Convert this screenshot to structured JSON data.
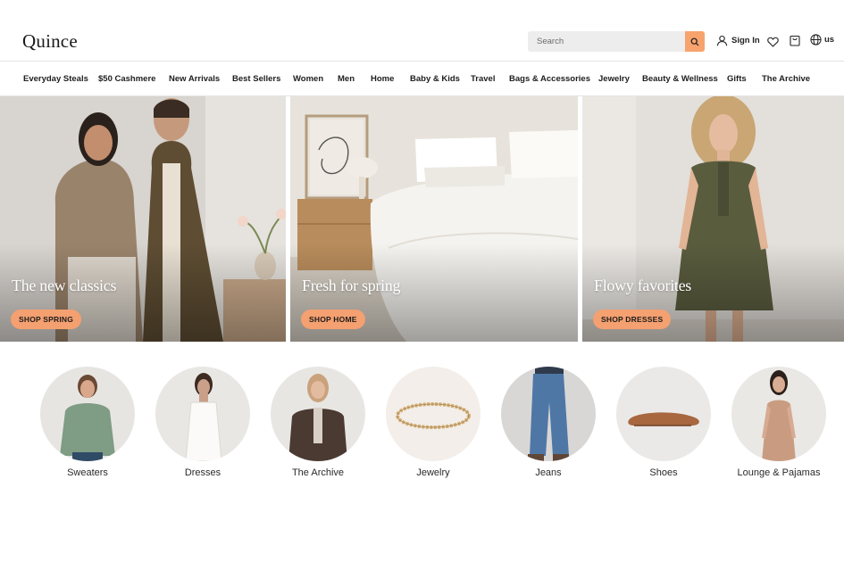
{
  "brand": {
    "logo": "Quince"
  },
  "header": {
    "search_placeholder": "Search",
    "sign_in": "Sign In",
    "locale": "us"
  },
  "nav": {
    "items": [
      "Everyday Steals",
      "$50 Cashmere",
      "New Arrivals",
      "Best Sellers",
      "Women",
      "Men",
      "Home",
      "Baby & Kids",
      "Travel",
      "Bags & Accessories",
      "Jewelry",
      "Beauty & Wellness",
      "Gifts",
      "The Archive"
    ]
  },
  "hero": [
    {
      "title": "The new classics",
      "button": "SHOP SPRING"
    },
    {
      "title": "Fresh for spring",
      "button": "SHOP HOME"
    },
    {
      "title": "Flowy favorites",
      "button": "SHOP DRESSES"
    }
  ],
  "categories": [
    {
      "label": "Sweaters"
    },
    {
      "label": "Dresses"
    },
    {
      "label": "The Archive"
    },
    {
      "label": "Jewelry"
    },
    {
      "label": "Jeans"
    },
    {
      "label": "Shoes"
    },
    {
      "label": "Lounge & Pajamas"
    }
  ],
  "colors": {
    "accent": "#f4a070",
    "search_button": "#f7a36e",
    "search_bg": "#ededed",
    "divider": "#e4e4e4"
  },
  "icons": {
    "search": "search-icon",
    "user": "user-icon",
    "wishlist": "heart-icon",
    "cart": "bag-icon",
    "locale": "globe-icon"
  }
}
